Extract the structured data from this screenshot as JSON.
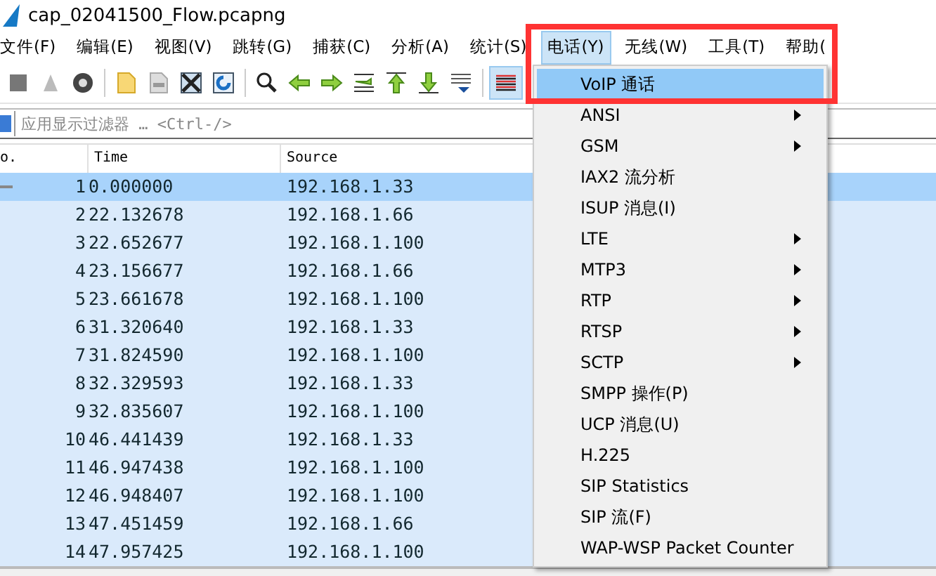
{
  "window": {
    "title": "cap_02041500_Flow.pcapng"
  },
  "menubar": [
    {
      "label": "文件(F)",
      "selected": false
    },
    {
      "label": "编辑(E)",
      "selected": false
    },
    {
      "label": "视图(V)",
      "selected": false
    },
    {
      "label": "跳转(G)",
      "selected": false
    },
    {
      "label": "捕获(C)",
      "selected": false
    },
    {
      "label": "分析(A)",
      "selected": false
    },
    {
      "label": "统计(S)",
      "selected": false
    },
    {
      "label": "电话(Y)",
      "selected": true
    },
    {
      "label": "无线(W)",
      "selected": false
    },
    {
      "label": "工具(T)",
      "selected": false
    },
    {
      "label": "帮助(",
      "selected": false
    }
  ],
  "filter": {
    "placeholder": "应用显示过滤器 … <Ctrl-/>"
  },
  "table": {
    "columns": [
      "o.",
      "Time",
      "Source"
    ],
    "rows": [
      {
        "no": "1",
        "time": "0.000000",
        "source": "192.168.1.33",
        "selected": true
      },
      {
        "no": "2",
        "time": "22.132678",
        "source": "192.168.1.66",
        "selected": false
      },
      {
        "no": "3",
        "time": "22.652677",
        "source": "192.168.1.100",
        "selected": false
      },
      {
        "no": "4",
        "time": "23.156677",
        "source": "192.168.1.66",
        "selected": false
      },
      {
        "no": "5",
        "time": "23.661678",
        "source": "192.168.1.100",
        "selected": false
      },
      {
        "no": "6",
        "time": "31.320640",
        "source": "192.168.1.33",
        "selected": false
      },
      {
        "no": "7",
        "time": "31.824590",
        "source": "192.168.1.100",
        "selected": false
      },
      {
        "no": "8",
        "time": "32.329593",
        "source": "192.168.1.33",
        "selected": false
      },
      {
        "no": "9",
        "time": "32.835607",
        "source": "192.168.1.100",
        "selected": false
      },
      {
        "no": "10",
        "time": "46.441439",
        "source": "192.168.1.33",
        "selected": false
      },
      {
        "no": "11",
        "time": "46.947438",
        "source": "192.168.1.100",
        "selected": false
      },
      {
        "no": "12",
        "time": "46.948407",
        "source": "192.168.1.100",
        "selected": false
      },
      {
        "no": "13",
        "time": "47.451459",
        "source": "192.168.1.66",
        "selected": false
      },
      {
        "no": "14",
        "time": "47.957425",
        "source": "192.168.1.100",
        "selected": false
      }
    ]
  },
  "dropdown": {
    "items": [
      {
        "label": "VoIP 通话",
        "selected": true,
        "submenu": false
      },
      {
        "label": "ANSI",
        "selected": false,
        "submenu": true
      },
      {
        "label": "GSM",
        "selected": false,
        "submenu": true
      },
      {
        "label": "IAX2 流分析",
        "selected": false,
        "submenu": false
      },
      {
        "label": "ISUP 消息(I)",
        "selected": false,
        "submenu": false
      },
      {
        "label": "LTE",
        "selected": false,
        "submenu": true
      },
      {
        "label": "MTP3",
        "selected": false,
        "submenu": true
      },
      {
        "label": "RTP",
        "selected": false,
        "submenu": true
      },
      {
        "label": "RTSP",
        "selected": false,
        "submenu": true
      },
      {
        "label": "SCTP",
        "selected": false,
        "submenu": true
      },
      {
        "label": "SMPP 操作(P)",
        "selected": false,
        "submenu": false
      },
      {
        "label": "UCP 消息(U)",
        "selected": false,
        "submenu": false
      },
      {
        "label": "H.225",
        "selected": false,
        "submenu": false
      },
      {
        "label": "SIP Statistics",
        "selected": false,
        "submenu": false
      },
      {
        "label": "SIP 流(F)",
        "selected": false,
        "submenu": false
      },
      {
        "label": "WAP-WSP Packet Counter",
        "selected": false,
        "submenu": false
      }
    ]
  }
}
